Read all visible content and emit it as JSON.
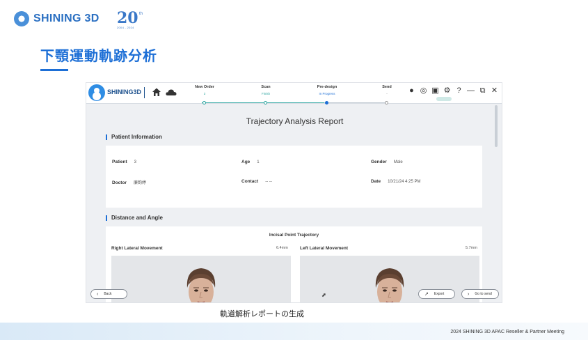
{
  "slide": {
    "brand": "SHINING 3D",
    "anniversary": {
      "number": "20",
      "suffix": "th",
      "years": "2004 - 2024"
    },
    "title": "下顎運動軌跡分析",
    "caption": "軌道解析レポートの生成",
    "footer": "2024 SHINING 3D APAC Reseller & Partner Meeting"
  },
  "app": {
    "brand": "SHINING3D",
    "steps": [
      {
        "name": "New Order",
        "sub": "3",
        "state": "done"
      },
      {
        "name": "Scan",
        "sub": "Finish",
        "state": "done"
      },
      {
        "name": "Pre-design",
        "sub": "In Progress",
        "state": "active"
      },
      {
        "name": "Send",
        "sub": "-",
        "state": "pending"
      }
    ],
    "icons": [
      "user-icon",
      "target-icon",
      "window-icon",
      "gear-icon",
      "help-icon",
      "minimize-icon",
      "restore-icon",
      "close-icon"
    ],
    "report_title": "Trajectory Analysis Report",
    "patient_section": "Patient Information",
    "patient": {
      "patient_label": "Patient",
      "patient_value": "3",
      "age_label": "Age",
      "age_value": "1",
      "gender_label": "Gender",
      "gender_value": "Male",
      "doctor_label": "Doctor",
      "doctor_value": "廉韵婷",
      "contact_label": "Contact",
      "contact_value": "-- --",
      "date_label": "Date",
      "date_value": "10/21/24 4:25 PM"
    },
    "distance_section": "Distance and Angle",
    "trajectory_title": "Incisal Point Trajectory",
    "right_label": "Right Lateral Movement",
    "right_value": "6.4mm",
    "left_label": "Left Lateral Movement",
    "left_value": "5.7mm",
    "buttons": {
      "back": "Back",
      "export": "Export",
      "go_to_send": "Go to send"
    }
  },
  "colors": {
    "accent": "#1d6fd6",
    "teal": "#2aa5a0"
  }
}
